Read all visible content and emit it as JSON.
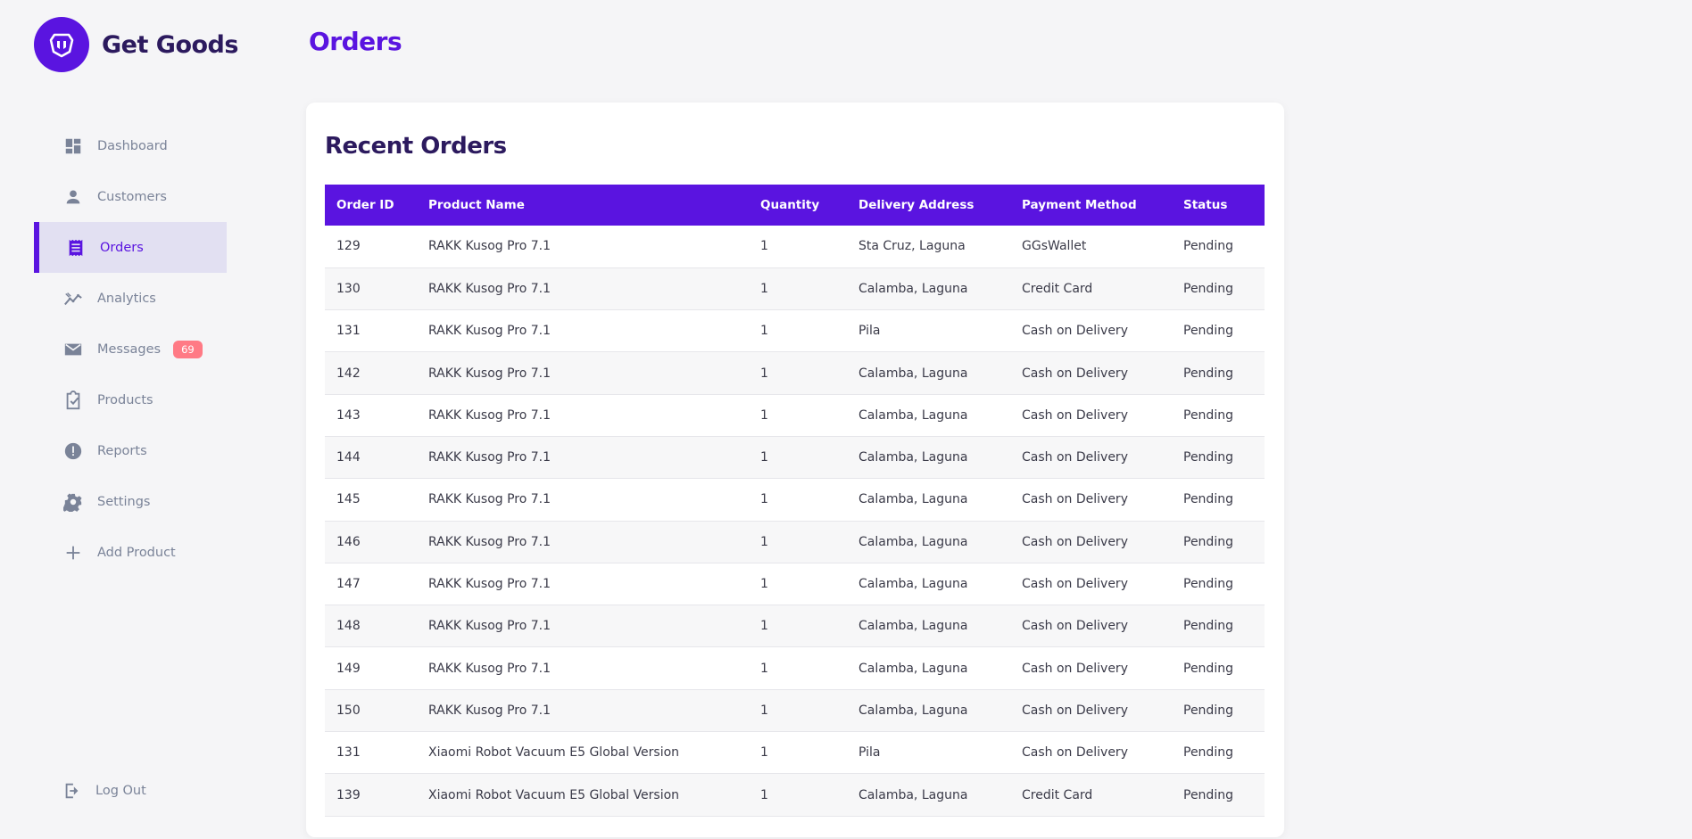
{
  "brand": {
    "name": "Get Goods"
  },
  "nav": [
    {
      "label": "Dashboard",
      "icon": "dashboard-icon"
    },
    {
      "label": "Customers",
      "icon": "person-icon"
    },
    {
      "label": "Orders",
      "icon": "receipt-icon",
      "active": true
    },
    {
      "label": "Analytics",
      "icon": "analytics-icon"
    },
    {
      "label": "Messages",
      "icon": "mail-icon",
      "badge": "69"
    },
    {
      "label": "Products",
      "icon": "clipboard-check-icon"
    },
    {
      "label": "Reports",
      "icon": "alert-icon"
    },
    {
      "label": "Settings",
      "icon": "gear-icon"
    },
    {
      "label": "Add Product",
      "icon": "plus-icon"
    }
  ],
  "logout": {
    "label": "Log Out"
  },
  "page": {
    "title": "Orders"
  },
  "orders": {
    "title": "Recent Orders",
    "columns": [
      "Order ID",
      "Product Name",
      "Quantity",
      "Delivery Address",
      "Payment Method",
      "Status"
    ],
    "rows": [
      [
        "129",
        "RAKK Kusog Pro 7.1",
        "1",
        "Sta Cruz, Laguna",
        "GGsWallet",
        "Pending"
      ],
      [
        "130",
        "RAKK Kusog Pro 7.1",
        "1",
        "Calamba, Laguna",
        "Credit Card",
        "Pending"
      ],
      [
        "131",
        "RAKK Kusog Pro 7.1",
        "1",
        "Pila",
        "Cash on Delivery",
        "Pending"
      ],
      [
        "142",
        "RAKK Kusog Pro 7.1",
        "1",
        "Calamba, Laguna",
        "Cash on Delivery",
        "Pending"
      ],
      [
        "143",
        "RAKK Kusog Pro 7.1",
        "1",
        "Calamba, Laguna",
        "Cash on Delivery",
        "Pending"
      ],
      [
        "144",
        "RAKK Kusog Pro 7.1",
        "1",
        "Calamba, Laguna",
        "Cash on Delivery",
        "Pending"
      ],
      [
        "145",
        "RAKK Kusog Pro 7.1",
        "1",
        "Calamba, Laguna",
        "Cash on Delivery",
        "Pending"
      ],
      [
        "146",
        "RAKK Kusog Pro 7.1",
        "1",
        "Calamba, Laguna",
        "Cash on Delivery",
        "Pending"
      ],
      [
        "147",
        "RAKK Kusog Pro 7.1",
        "1",
        "Calamba, Laguna",
        "Cash on Delivery",
        "Pending"
      ],
      [
        "148",
        "RAKK Kusog Pro 7.1",
        "1",
        "Calamba, Laguna",
        "Cash on Delivery",
        "Pending"
      ],
      [
        "149",
        "RAKK Kusog Pro 7.1",
        "1",
        "Calamba, Laguna",
        "Cash on Delivery",
        "Pending"
      ],
      [
        "150",
        "RAKK Kusog Pro 7.1",
        "1",
        "Calamba, Laguna",
        "Cash on Delivery",
        "Pending"
      ],
      [
        "131",
        "Xiaomi Robot Vacuum E5 Global Version",
        "1",
        "Pila",
        "Cash on Delivery",
        "Pending"
      ],
      [
        "139",
        "Xiaomi Robot Vacuum E5 Global Version",
        "1",
        "Calamba, Laguna",
        "Credit Card",
        "Pending"
      ]
    ]
  },
  "colors": {
    "accent": "#5a14e0",
    "badge": "#ff7a85",
    "title_dark": "#2c1a5e"
  }
}
